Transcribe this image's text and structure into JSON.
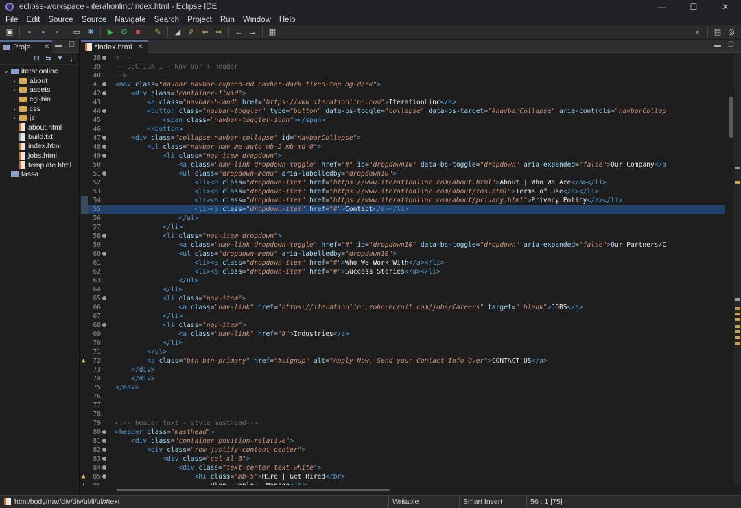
{
  "window": {
    "title": "eclipse-workspace - iterationlinc/index.html - Eclipse IDE",
    "controls": {
      "minimize": "—",
      "maximize": "☐",
      "close": "✕"
    }
  },
  "menu": [
    "File",
    "Edit",
    "Source",
    "Source",
    "Navigate",
    "Search",
    "Project",
    "Run",
    "Window",
    "Help"
  ],
  "toolbar": {
    "icons": [
      "new-icon",
      "save-icon",
      "save-all-icon",
      "print-icon",
      "terminal-icon",
      "debug-icon",
      "run-icon",
      "external-tools-icon",
      "stop-icon",
      "edit-icon",
      "format-icon",
      "annotation-icon",
      "prev-annotation-icon",
      "next-edit-icon",
      "back-icon",
      "forward-icon",
      "open-perspective-icon"
    ],
    "search_icon": "search-icon",
    "perspective_icons": [
      "perspective-java-icon",
      "perspective-web-icon"
    ]
  },
  "explorer": {
    "tab_label": "Proje...",
    "close": "✕",
    "tree": [
      {
        "label": "iterationlinc",
        "type": "project",
        "depth": 0,
        "expanded": true
      },
      {
        "label": "about",
        "type": "folder",
        "depth": 1,
        "expanded": false
      },
      {
        "label": "assets",
        "type": "folder",
        "depth": 1,
        "expanded": false
      },
      {
        "label": "cgi-bin",
        "type": "folder",
        "depth": 1,
        "expanded": null
      },
      {
        "label": "css",
        "type": "folder",
        "depth": 1,
        "expanded": false
      },
      {
        "label": "js",
        "type": "folder",
        "depth": 1,
        "expanded": false
      },
      {
        "label": "about.html",
        "type": "html",
        "depth": 1,
        "expanded": null
      },
      {
        "label": "build.txt",
        "type": "txt",
        "depth": 1,
        "expanded": null
      },
      {
        "label": "index.html",
        "type": "html",
        "depth": 1,
        "expanded": null
      },
      {
        "label": "jobs.html",
        "type": "html",
        "depth": 1,
        "expanded": null
      },
      {
        "label": "template.html",
        "type": "html",
        "depth": 1,
        "expanded": null
      },
      {
        "label": "tassa",
        "type": "project",
        "depth": 0,
        "expanded": null
      }
    ]
  },
  "editor": {
    "tab_label": "*index.html",
    "close": "✕",
    "current_line": 55,
    "lines": [
      {
        "n": "38",
        "fold": true,
        "text": "<!--"
      },
      {
        "n": "39",
        "text": "-- SECTION 1 - Nav Bar + Header"
      },
      {
        "n": "40",
        "text": "-->"
      },
      {
        "n": "41",
        "fold": true,
        "text": "<nav class=\"navbar navbar-expand-md navbar-dark fixed-top bg-dark\">"
      },
      {
        "n": "42",
        "fold": true,
        "text": "    <div class=\"container-fluid\">"
      },
      {
        "n": "43",
        "text": "        <a class=\"navbar-brand\" href=\"https://www.iterationlinc.com\">IterationLinc</a>"
      },
      {
        "n": "44",
        "fold": true,
        "text": "        <button class=\"navbar-toggler\" type=\"button\" data-bs-toggle=\"collapse\" data-bs-target=\"#navbarCollapse\" aria-controls=\"navbarCollap"
      },
      {
        "n": "45",
        "text": "            <span class=\"navbar-toggler-icon\"></span>"
      },
      {
        "n": "46",
        "text": "        </button>"
      },
      {
        "n": "47",
        "fold": true,
        "text": "    <div class=\"collapse navbar-collapse\" id=\"navbarCollapse\">"
      },
      {
        "n": "48",
        "fold": true,
        "text": "        <ul class=\"navbar-nav me-auto mb-2 mb-md-0\">"
      },
      {
        "n": "49",
        "fold": true,
        "text": "            <li class=\"nav-item dropdown\">"
      },
      {
        "n": "50",
        "text": "                <a class=\"nav-link dropdown-toggle\" href=\"#\" id=\"dropdown10\" data-bs-toggle=\"dropdown\" aria-expanded=\"false\">Our Company</a"
      },
      {
        "n": "51",
        "fold": true,
        "text": "                <ul class=\"dropdown-menu\" aria-labelledby=\"dropdown10\">"
      },
      {
        "n": "52",
        "text": "                    <li><a class=\"dropdown-item\" href=\"https://www.iterationlinc.com/about.html\">About | Who We Are</a></li>"
      },
      {
        "n": "53",
        "text": "                    <li><a class=\"dropdown-item\" href=\"https://www.iterationlinc.com/about/tos.html\">Terms of Use</a></li>"
      },
      {
        "n": "54",
        "text": "                    <li><a class=\"dropdown-item\" href=\"https://www.iterationlinc.com/about/privacy.html\">Privacy Policy</a></li>"
      },
      {
        "n": "55",
        "text": "                    <li><a class=\"dropdown-item\" href=\"#\">Contact</a></li>",
        "current": true
      },
      {
        "n": "56",
        "text": "                </ul>"
      },
      {
        "n": "57",
        "text": "            </li>"
      },
      {
        "n": "58",
        "fold": true,
        "text": "            <li class=\"nav-item dropdown\">"
      },
      {
        "n": "59",
        "text": "                <a class=\"nav-link dropdown-toggle\" href=\"#\" id=\"dropdown10\" data-bs-toggle=\"dropdown\" aria-expanded=\"false\">Our Partners/C"
      },
      {
        "n": "60",
        "fold": true,
        "text": "                <ul class=\"dropdown-menu\" aria-labelledby=\"dropdown10\">"
      },
      {
        "n": "61",
        "text": "                    <li><a class=\"dropdown-item\" href=\"#\">Who We Work With</a></li>"
      },
      {
        "n": "62",
        "text": "                    <li><a class=\"dropdown-item\" href=\"#\">Success Stories</a></li>"
      },
      {
        "n": "63",
        "text": "                </ul>"
      },
      {
        "n": "64",
        "text": "            </li>"
      },
      {
        "n": "65",
        "fold": true,
        "text": "            <li class=\"nav-item\">"
      },
      {
        "n": "66",
        "text": "                <a class=\"nav-link\" href=\"https://iterationlinc.zohorecruit.com/jobs/Careers\" target=\"_blank\">JOBS</a>"
      },
      {
        "n": "67",
        "text": "            </li>"
      },
      {
        "n": "68",
        "fold": true,
        "text": "            <li class=\"nav-item\">"
      },
      {
        "n": "69",
        "text": "                <a class=\"nav-link\" href=\"#\">Industries</a>"
      },
      {
        "n": "70",
        "text": "            </li>"
      },
      {
        "n": "71",
        "text": "        </ul>"
      },
      {
        "n": "72",
        "warn": true,
        "text": "        <a class=\"btn btn-primary\" href=\"#signup\" alt=\"Apply Now, Send your Contact Info Over\">CONTACT US</a>"
      },
      {
        "n": "73",
        "text": "    </div>"
      },
      {
        "n": "74",
        "text": "    </div>"
      },
      {
        "n": "75",
        "text": "</nav>"
      },
      {
        "n": "76",
        "text": ""
      },
      {
        "n": "77",
        "text": ""
      },
      {
        "n": "78",
        "text": ""
      },
      {
        "n": "79",
        "text": "<!-- header text - style masthead-->"
      },
      {
        "n": "80",
        "fold": true,
        "text": "<header class=\"masthead\">"
      },
      {
        "n": "81",
        "fold": true,
        "text": "    <div class=\"container position-relative\">"
      },
      {
        "n": "82",
        "fold": true,
        "text": "        <div class=\"row justify-content-center\">"
      },
      {
        "n": "83",
        "fold": true,
        "text": "            <div class=\"col-xl-6\">"
      },
      {
        "n": "84",
        "fold": true,
        "text": "                <div class=\"text-center text-white\">"
      },
      {
        "n": "85",
        "fold": true,
        "warn": true,
        "text": "                    <h1 class=\"mb-5\">Hire | Get Hired</br>"
      },
      {
        "n": "86",
        "warn": true,
        "text": "                        Plan, Deploy, Manage</br>"
      }
    ]
  },
  "status": {
    "path": "html/body/nav/div/div/ul/li/ul/#text",
    "mode": "Writable",
    "insert": "Smart Insert",
    "position": "56 : 1 [75]"
  }
}
